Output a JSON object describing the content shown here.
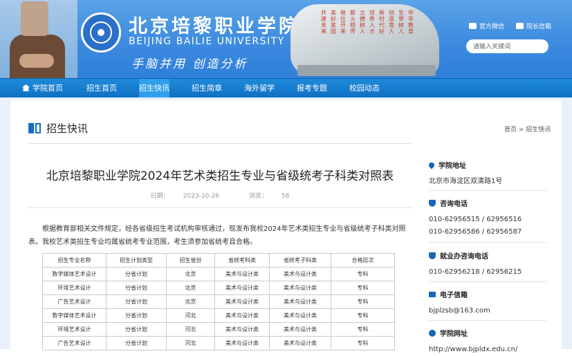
{
  "header": {
    "name_cn": "北京培黎职业学院",
    "name_en": "BEIJING BAILIE UNIVERSITY",
    "motto": "手脑并用 创造分析",
    "stone_columns": [
      "中华教育",
      "生草树人",
      "创造育人",
      "新时代好",
      "培养人才",
      "立德树人",
      "薪火相传",
      "继往开来",
      "美好家园",
      "共建未来"
    ],
    "top_links": [
      {
        "label": "官方微信",
        "icon": "wechat-icon"
      },
      {
        "label": "院长信箱",
        "icon": "mail-icon"
      }
    ],
    "search_placeholder": "请输入关键词"
  },
  "nav": {
    "items": [
      "学院首页",
      "招生首页",
      "招生快讯",
      "招生简章",
      "海外留学",
      "报考专题",
      "校园动态"
    ],
    "active": "招生快讯"
  },
  "section": {
    "title": "招生快讯"
  },
  "breadcrumb": {
    "home": "首页",
    "sep": " > ",
    "current": "招生快讯"
  },
  "article": {
    "title": "北京培黎职业学院2024年艺术类招生专业与省级统考子科类对照表",
    "date_label": "日期：",
    "date": "2023-10-26",
    "views_label": "浏览：",
    "views": "58",
    "paragraph": "根据教育部相关文件规定，经各省级招生考试机构审核通过，现发布我校2024年艺术类招生专业与省级统考子科类对照表。我校艺术类招生专业均属省统考专业范围，考生须参加省统考且合格。",
    "table": {
      "headers": [
        "招生专业名称",
        "招生计划类型",
        "招生省份",
        "省统考科类",
        "省统考子科类",
        "合格层次"
      ],
      "rows": [
        [
          "数字媒体艺术设计",
          "分省计划",
          "北京",
          "美术与设计类",
          "美术与设计类",
          "专科"
        ],
        [
          "环境艺术设计",
          "分省计划",
          "北京",
          "美术与设计类",
          "美术与设计类",
          "专科"
        ],
        [
          "广告艺术设计",
          "分省计划",
          "北京",
          "美术与设计类",
          "美术与设计类",
          "专科"
        ],
        [
          "数字媒体艺术设计",
          "分省计划",
          "河北",
          "美术与设计类",
          "美术与设计类",
          "专科"
        ],
        [
          "环境艺术设计",
          "分省计划",
          "河北",
          "美术与设计类",
          "美术与设计类",
          "专科"
        ],
        [
          "广告艺术设计",
          "分省计划",
          "河北",
          "美术与设计类",
          "美术与设计类",
          "专科"
        ]
      ]
    }
  },
  "sidebar": {
    "address": {
      "label": "学院地址",
      "value": "北京市海淀区双清路1号"
    },
    "phone": {
      "label": "咨询电话",
      "lines": [
        "010-62956515 / 62956516",
        "010-62956586 / 62956587"
      ]
    },
    "job_phone": {
      "label": "就业办咨询电话",
      "lines": [
        "010-62956218 / 62956215"
      ]
    },
    "email": {
      "label": "电子信箱",
      "value": "bjplzsb@163.com"
    },
    "web": {
      "label": "学院网址",
      "value": "http://www.bjpldx.edu.cn/"
    }
  }
}
